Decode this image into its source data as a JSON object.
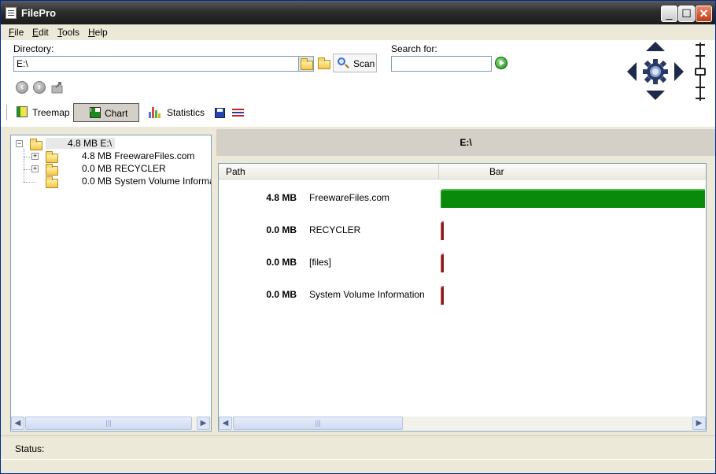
{
  "window": {
    "title": "FilePro"
  },
  "menu": [
    "File",
    "Edit",
    "Tools",
    "Help"
  ],
  "toolbar": {
    "directory_label": "Directory:",
    "directory_value": "E:\\",
    "scan_label": "Scan",
    "search_label": "Search for:",
    "search_value": ""
  },
  "views": {
    "treemap": "Treemap",
    "chart": "Chart",
    "statistics": "Statistics",
    "active": "Chart"
  },
  "tree": {
    "root": {
      "size": "4.8 MB",
      "name": "E:\\"
    },
    "children": [
      {
        "size": "4.8 MB",
        "name": "FreewareFiles.com",
        "expandable": true
      },
      {
        "size": "0.0 MB",
        "name": "RECYCLER",
        "expandable": true
      },
      {
        "size": "0.0 MB",
        "name": "System Volume Informatior",
        "expandable": false
      }
    ]
  },
  "chart_view": {
    "header": "E:\\",
    "columns": {
      "path": "Path",
      "bar": "Bar"
    },
    "rows": [
      {
        "size": "4.8 MB",
        "name": "FreewareFiles.com",
        "fraction": 1.0,
        "color": "#0a8a0a"
      },
      {
        "size": "0.0 MB",
        "name": "RECYCLER",
        "fraction": 0.0,
        "color": "#8a1a1a"
      },
      {
        "size": "0.0 MB",
        "name": "[files]",
        "fraction": 0.0,
        "color": "#8a1a1a"
      },
      {
        "size": "0.0 MB",
        "name": "System Volume Information",
        "fraction": 0.0,
        "color": "#8a1a1a"
      }
    ]
  },
  "status": {
    "label": "Status:",
    "text": ""
  },
  "colors": {
    "titlebar": "#2d2d2d",
    "bar_main": "#0a8a0a",
    "bar_empty": "#8a1a1a"
  }
}
